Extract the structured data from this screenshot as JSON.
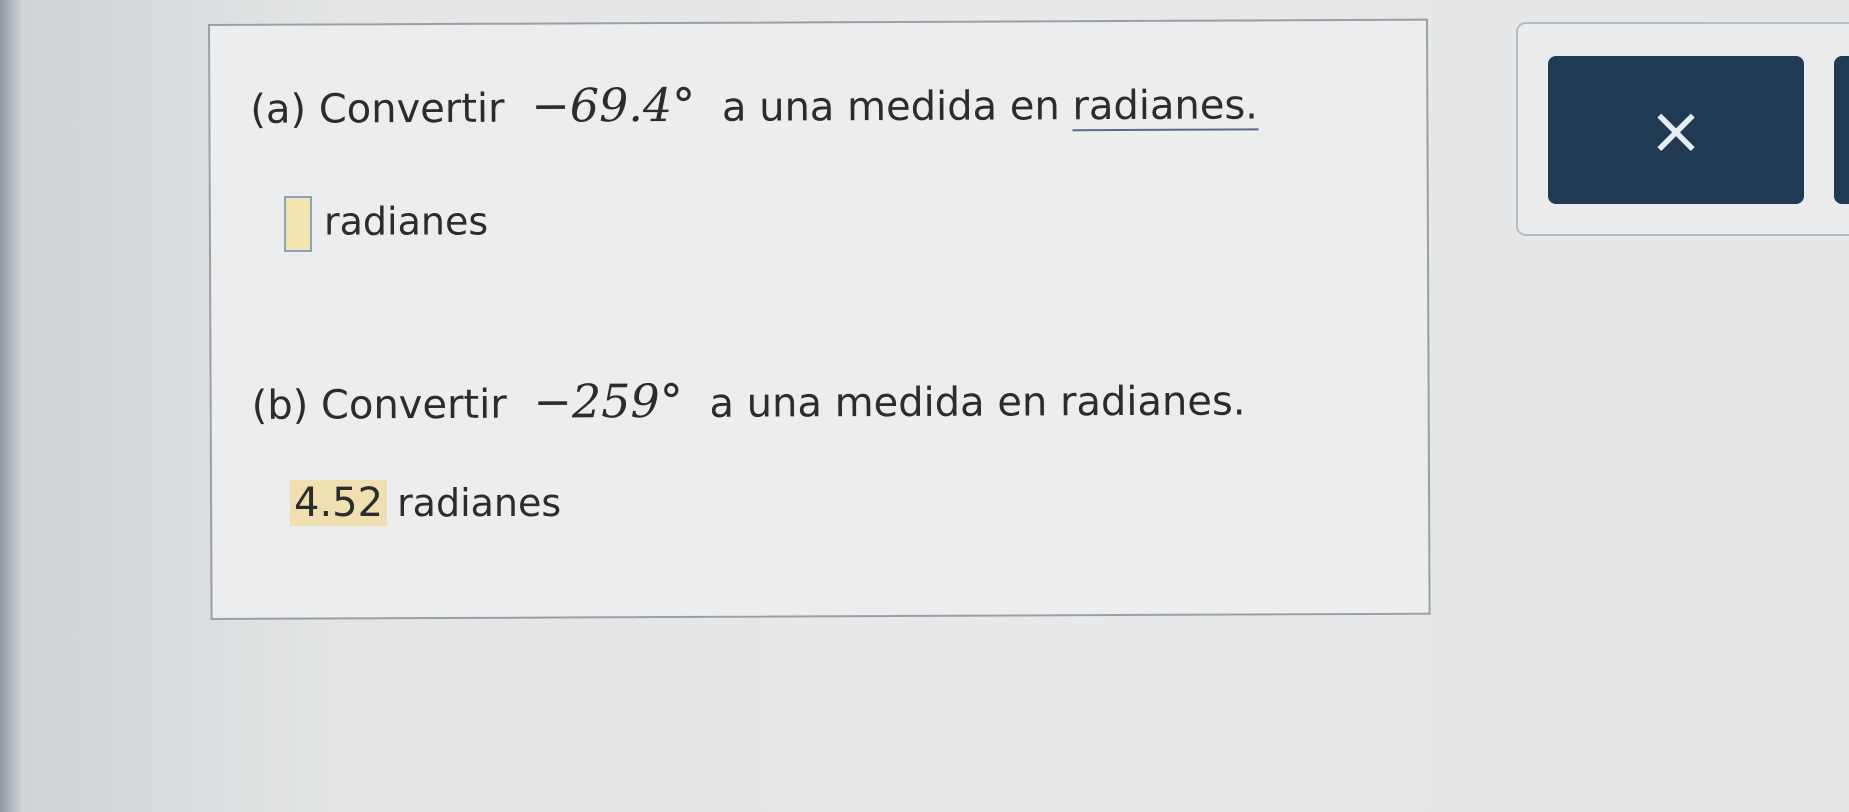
{
  "question_a": {
    "label": "(a) Convertir",
    "angle": "−69.4°",
    "suffix_before_link": "a una medida en ",
    "link_text": "radianes."
  },
  "answer_a": {
    "value": "",
    "unit": "radianes"
  },
  "question_b": {
    "label": "(b) Convertir",
    "angle": "−259°",
    "suffix": "a una medida en radianes."
  },
  "answer_b": {
    "value": "4.52",
    "unit": "radianes"
  },
  "close_button": {
    "label": "×",
    "icon": "close-icon"
  },
  "colors": {
    "button_bg": "#1f3a52",
    "answer_highlight": "#f0dfb0"
  }
}
